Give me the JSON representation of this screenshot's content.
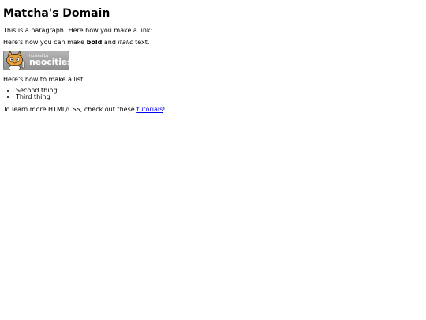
{
  "title": "Matcha's Domain",
  "paragraph_link_intro": "This is a paragraph! Here how you make a link:",
  "formatting": {
    "prefix": "Here's how you can make ",
    "bold": "bold",
    "middle": " and ",
    "italic": "italic",
    "suffix": " text."
  },
  "badge": {
    "small_text": "hosted by",
    "big_text": "neocities",
    "icon": "neocities-cat-icon"
  },
  "list_intro": "Here's how to make a list:",
  "list_items": [
    "Second thing",
    "Third thing"
  ],
  "learn_more": {
    "prefix": "To learn more HTML/CSS, check out these ",
    "link_text": "tutorials",
    "suffix": "!"
  },
  "colors": {
    "link": "#0000ee",
    "badge_bg": "#a6a6a6",
    "cat_orange": "#f0a23a"
  }
}
